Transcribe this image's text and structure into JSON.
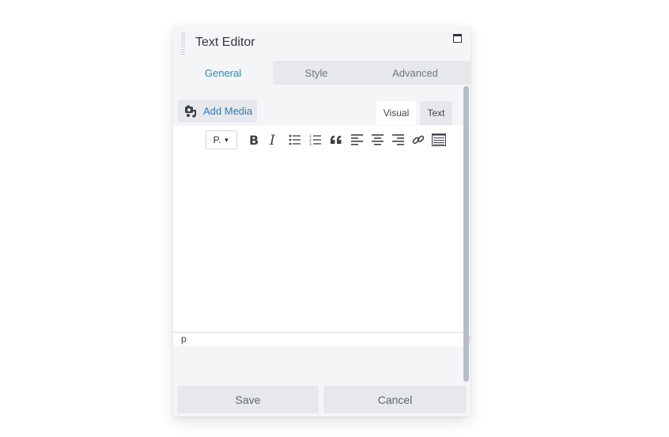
{
  "panel": {
    "title": "Text Editor",
    "maximize_icon": "window-maximize-icon"
  },
  "tabs": [
    {
      "label": "General",
      "active": true
    },
    {
      "label": "Style",
      "active": false
    },
    {
      "label": "Advanced",
      "active": false
    }
  ],
  "editor": {
    "add_media_label": "Add Media",
    "add_media_icon": "media-icon",
    "mode_tabs": [
      {
        "label": "Visual",
        "active": true
      },
      {
        "label": "Text",
        "active": false
      }
    ],
    "format_select_value": "P.",
    "toolbar_icons": [
      "bold-icon",
      "italic-icon",
      "bullet-list-icon",
      "numbered-list-icon",
      "blockquote-icon",
      "align-left-icon",
      "align-center-icon",
      "align-right-icon",
      "link-icon",
      "toolbar-toggle-icon"
    ],
    "content": "",
    "status_path": "p"
  },
  "footer": {
    "save_label": "Save",
    "cancel_label": "Cancel"
  },
  "colors": {
    "accent": "#1d8fb0",
    "link": "#2f7bb8",
    "panel_bg": "#f4f5f7",
    "tab_bg": "#e6e8ec"
  }
}
